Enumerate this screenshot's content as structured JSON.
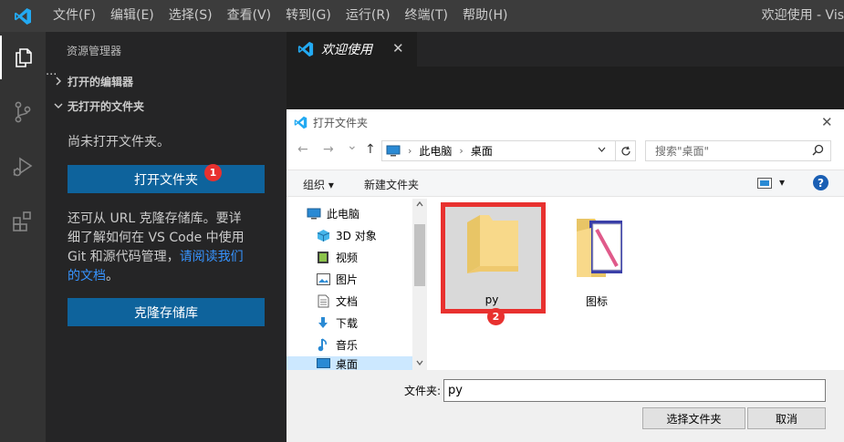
{
  "menu": {
    "items": [
      "文件(F)",
      "编辑(E)",
      "选择(S)",
      "查看(V)",
      "转到(G)",
      "运行(R)",
      "终端(T)",
      "帮助(H)"
    ],
    "window_title": "欢迎使用 - Vis"
  },
  "colors": {
    "accent": "#0e639c",
    "link": "#3794ff",
    "badge": "#e8312f",
    "vscode_blue": "#23aaf2"
  },
  "activity": [
    "explorer-icon",
    "source-control-icon",
    "run-debug-icon",
    "extensions-icon"
  ],
  "sidebar": {
    "title": "资源管理器",
    "more": "···",
    "open_editors": "打开的编辑器",
    "no_folder": "无打开的文件夹",
    "no_folder_msg": "尚未打开文件夹。",
    "open_folder_btn": "打开文件夹",
    "badge1": "1",
    "clone_msg_1": "还可从 URL 克隆存储库。要详",
    "clone_msg_2": "细了解如何在 VS Code 中使用",
    "clone_msg_3": "Git 和源代码管理，",
    "clone_link_1": "请阅读我们",
    "clone_link_2": "的文档",
    "clone_msg_end": "。",
    "clone_btn": "克隆存储库"
  },
  "tab": {
    "label": "欢迎使用",
    "close": "✕"
  },
  "dialog": {
    "title": "打开文件夹",
    "close": "✕",
    "nav_back": "←",
    "nav_forward": "→",
    "nav_recent": "⌄",
    "nav_up": "↑",
    "breadcrumb": [
      "此电脑",
      "桌面"
    ],
    "breadcrumb_sep": "›",
    "search_placeholder": "搜索\"桌面\"",
    "organize": "组织 ▾",
    "new_folder": "新建文件夹",
    "view_dd": "▾",
    "help": "?",
    "nav_items": [
      {
        "label": "此电脑",
        "icon": "computer-icon"
      },
      {
        "label": "3D 对象",
        "icon": "3d-objects-icon"
      },
      {
        "label": "视频",
        "icon": "video-icon"
      },
      {
        "label": "图片",
        "icon": "pictures-icon"
      },
      {
        "label": "文档",
        "icon": "documents-icon"
      },
      {
        "label": "下载",
        "icon": "downloads-icon"
      },
      {
        "label": "音乐",
        "icon": "music-icon"
      },
      {
        "label": "桌面",
        "icon": "desktop-icon"
      }
    ],
    "files": [
      {
        "name": "py",
        "selected": true
      },
      {
        "name": "图标",
        "selected": false
      }
    ],
    "badge2": "2",
    "folder_label": "文件夹:",
    "folder_value": "py",
    "select_btn": "选择文件夹",
    "cancel_btn": "取消"
  }
}
